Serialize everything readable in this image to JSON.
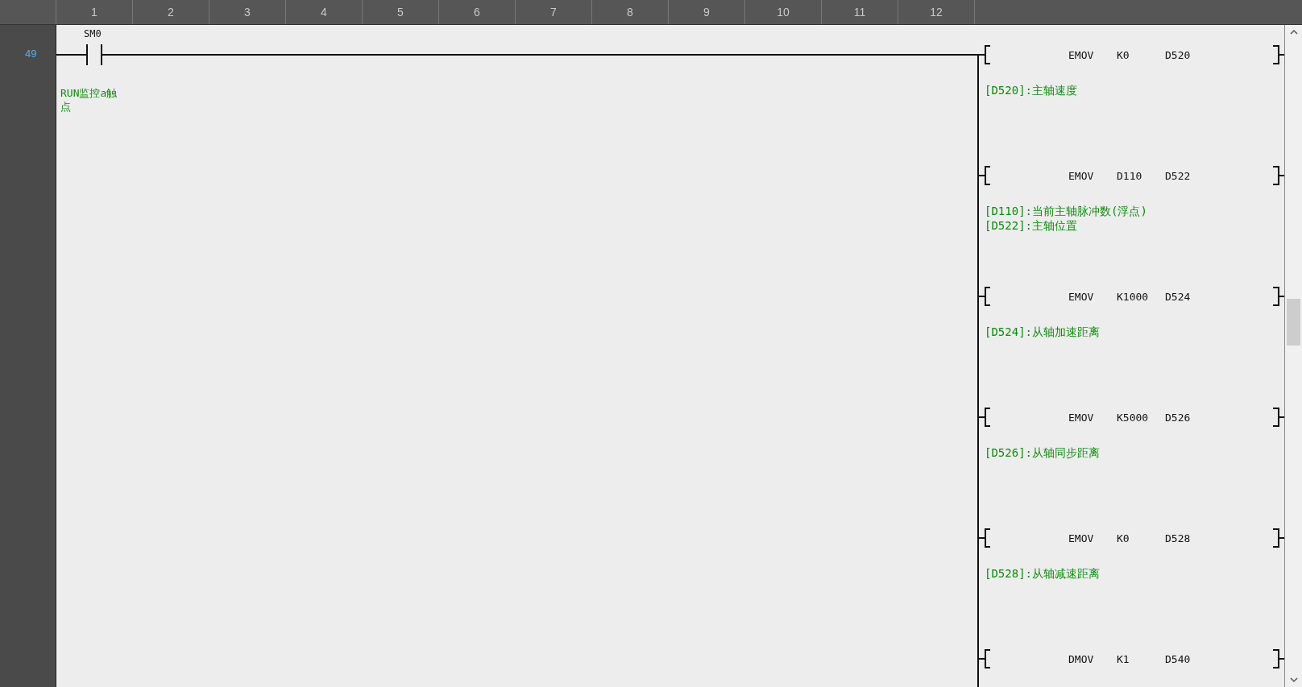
{
  "columns": [
    "1",
    "2",
    "3",
    "4",
    "5",
    "6",
    "7",
    "8",
    "9",
    "10",
    "11",
    "12"
  ],
  "rung": {
    "number": "49",
    "contact": {
      "device": "SM0",
      "comment": "RUN监控a触点"
    },
    "instructions": [
      {
        "mnemonic": "EMOV",
        "operands": [
          "K0",
          "D520"
        ],
        "comments": [
          "[D520]:主轴速度"
        ]
      },
      {
        "mnemonic": "EMOV",
        "operands": [
          "D110",
          "D522"
        ],
        "comments": [
          "[D110]:当前主轴脉冲数(浮点)",
          "[D522]:主轴位置"
        ]
      },
      {
        "mnemonic": "EMOV",
        "operands": [
          "K1000",
          "D524"
        ],
        "comments": [
          "[D524]:从轴加速距离"
        ]
      },
      {
        "mnemonic": "EMOV",
        "operands": [
          "K5000",
          "D526"
        ],
        "comments": [
          "[D526]:从轴同步距离"
        ]
      },
      {
        "mnemonic": "EMOV",
        "operands": [
          "K0",
          "D528"
        ],
        "comments": [
          "[D528]:从轴减速距离"
        ]
      },
      {
        "mnemonic": "DMOV",
        "operands": [
          "K1",
          "D540"
        ]
      }
    ]
  }
}
